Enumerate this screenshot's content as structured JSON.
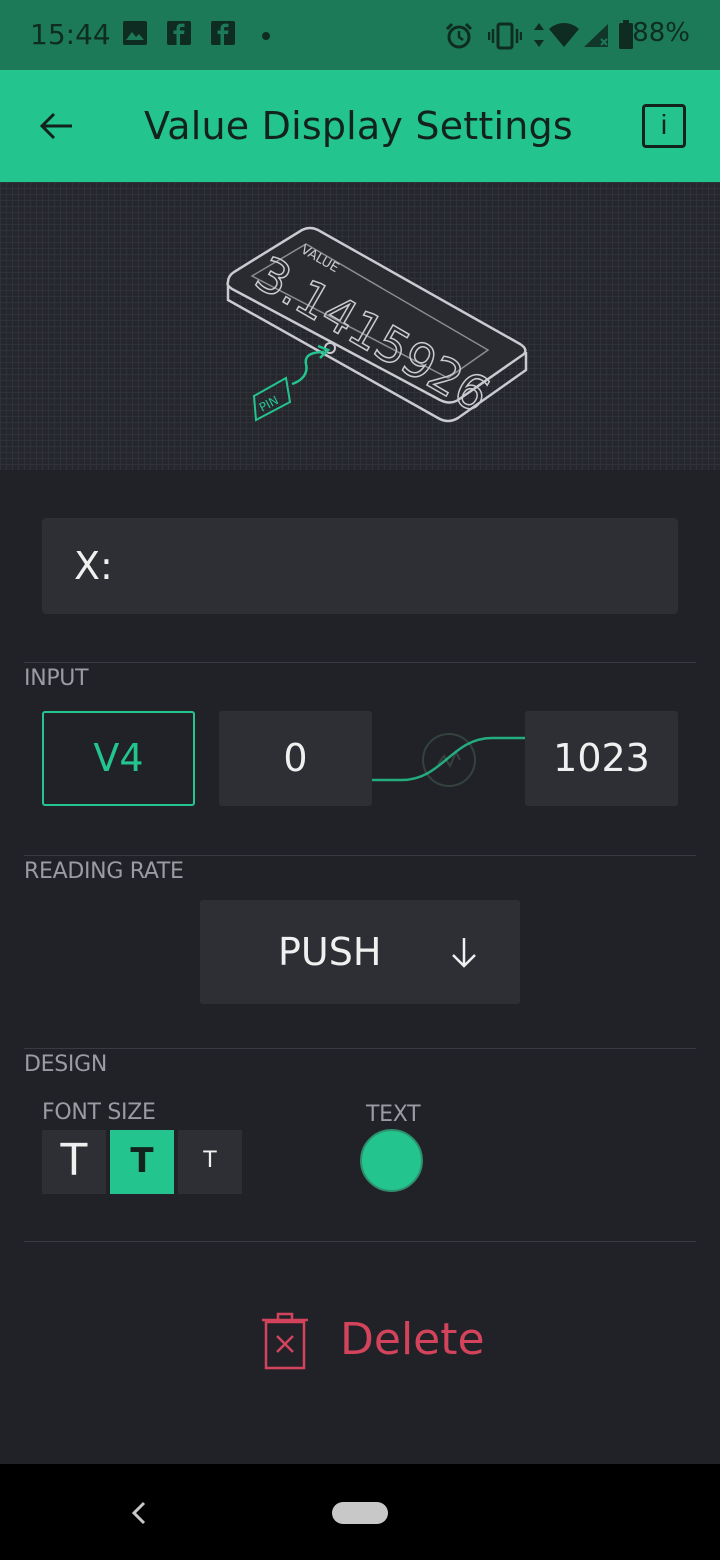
{
  "status_bar": {
    "time": "15:44",
    "battery": "88%",
    "icons": [
      "image-icon",
      "facebook-icon",
      "facebook-icon",
      "dot-icon",
      "alarm-icon",
      "vibrate-icon",
      "data-arrows-icon",
      "wifi-icon",
      "signal-icon",
      "battery-icon"
    ]
  },
  "app_bar": {
    "title": "Value Display Settings",
    "info_label": "i"
  },
  "hero": {
    "widget_label": "VALUE",
    "widget_value": "3.1415926",
    "pin_label": "PIN"
  },
  "name_field": {
    "label": "X:"
  },
  "input": {
    "section_label": "INPUT",
    "pin": "V4",
    "min": "0",
    "max": "1023"
  },
  "reading_rate": {
    "section_label": "READING RATE",
    "value": "PUSH"
  },
  "design": {
    "section_label": "DESIGN",
    "font_size_label": "FONT SIZE",
    "font_sizes": [
      "T",
      "T",
      "T"
    ],
    "selected_font_size_index": 1,
    "text_color_label": "TEXT",
    "text_color": "#23c48e"
  },
  "actions": {
    "delete_label": "Delete"
  },
  "colors": {
    "accent": "#23c48e",
    "status_bar": "#1d7a59",
    "background": "#212227",
    "danger": "#d3435c"
  }
}
